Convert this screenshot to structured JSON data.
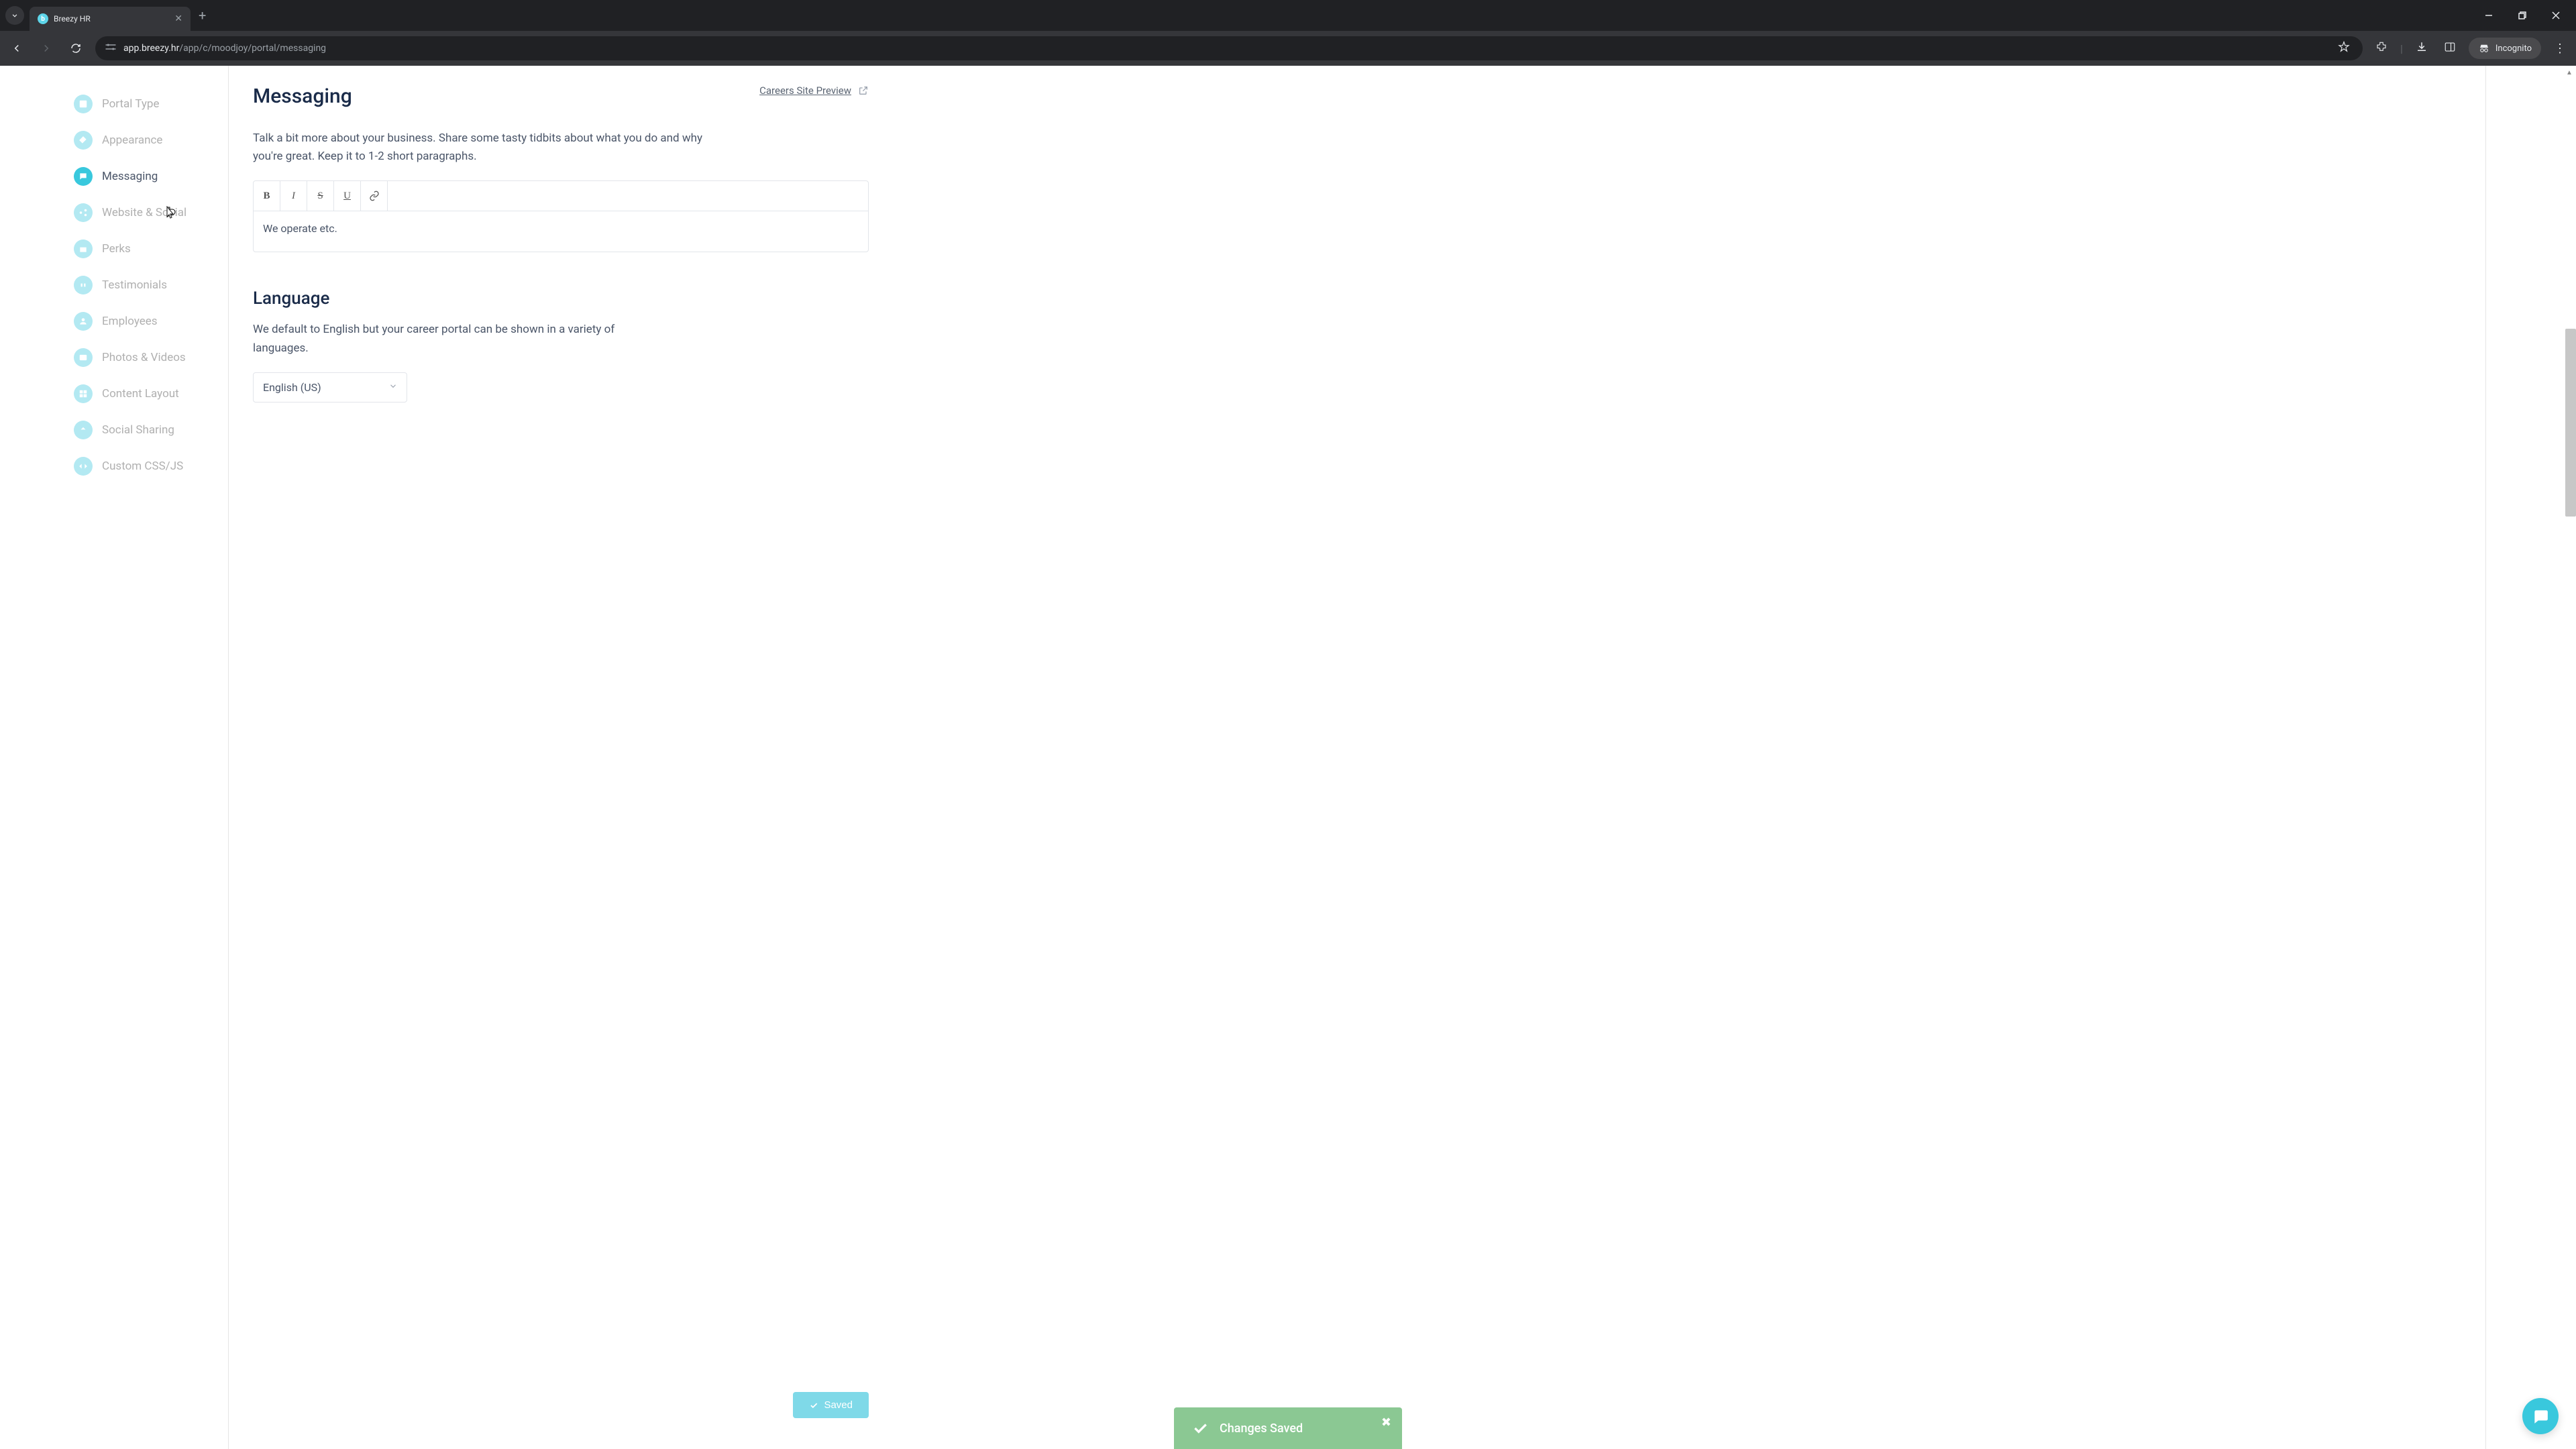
{
  "browser": {
    "tab_title": "Breezy HR",
    "url_domain": "app.breezy.hr",
    "url_path": "/app/c/moodjoy/portal/messaging",
    "incognito_label": "Incognito"
  },
  "sidebar": {
    "items": [
      {
        "label": "Portal Type",
        "icon": "layout-icon"
      },
      {
        "label": "Appearance",
        "icon": "brush-icon"
      },
      {
        "label": "Messaging",
        "icon": "chat-icon"
      },
      {
        "label": "Website & Social",
        "icon": "share-icon"
      },
      {
        "label": "Perks",
        "icon": "gift-icon"
      },
      {
        "label": "Testimonials",
        "icon": "quote-icon"
      },
      {
        "label": "Employees",
        "icon": "people-icon"
      },
      {
        "label": "Photos & Videos",
        "icon": "image-icon"
      },
      {
        "label": "Content Layout",
        "icon": "grid-icon"
      },
      {
        "label": "Social Sharing",
        "icon": "share-alt-icon"
      },
      {
        "label": "Custom CSS/JS",
        "icon": "code-icon"
      }
    ],
    "active_index": 2
  },
  "main": {
    "title": "Messaging",
    "preview_link": "Careers Site Preview",
    "help_text": "Talk a bit more about your business. Share some tasty tidbits about what you do and why you're great. Keep it to 1-2 short paragraphs.",
    "editor": {
      "tools": {
        "bold": "B",
        "italic": "I",
        "strike": "S",
        "underline": "U"
      },
      "content": "We operate etc."
    },
    "language": {
      "title": "Language",
      "help_text": "We default to English but your career portal can be shown in a variety of languages.",
      "selected": "English (US)"
    },
    "saved_button": "Saved"
  },
  "toast": {
    "message": "Changes Saved"
  }
}
